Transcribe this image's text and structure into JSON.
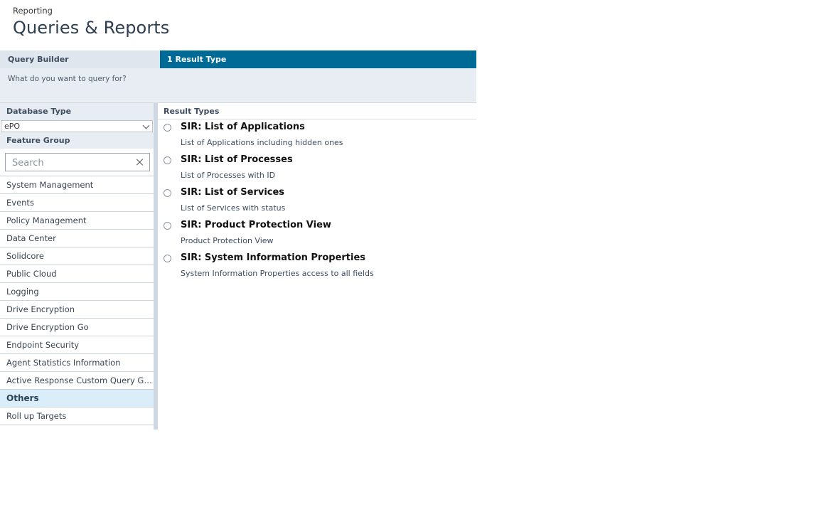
{
  "header": {
    "breadcrumb": "Reporting",
    "title": "Queries & Reports"
  },
  "query_builder": {
    "label": "Query Builder",
    "active_tab": "1 Result Type",
    "question": "What do you want to query for?"
  },
  "database_type": {
    "label": "Database Type",
    "selected": "ePO"
  },
  "feature_group": {
    "label": "Feature Group",
    "search_placeholder": "Search",
    "items": [
      "System Management",
      "Events",
      "Policy Management",
      "Data Center",
      "Solidcore",
      "Public Cloud",
      "Logging",
      "Drive Encryption",
      "Drive Encryption Go",
      "Endpoint Security",
      "Agent Statistics Information",
      "Active Response Custom Query Gro...",
      "Others",
      "Roll up Targets"
    ],
    "selected_index": 12
  },
  "result_types": {
    "label": "Result Types",
    "items": [
      {
        "title": "SIR: List of Applications",
        "desc": "List of Applications including hidden ones"
      },
      {
        "title": "SIR: List of Processes",
        "desc": "List of Processes with ID"
      },
      {
        "title": "SIR: List of Services",
        "desc": "List of Services with status"
      },
      {
        "title": "SIR: Product Protection View",
        "desc": "Product Protection View"
      },
      {
        "title": "SIR: System Information Properties",
        "desc": "System Information Properties access to all fields"
      }
    ]
  }
}
